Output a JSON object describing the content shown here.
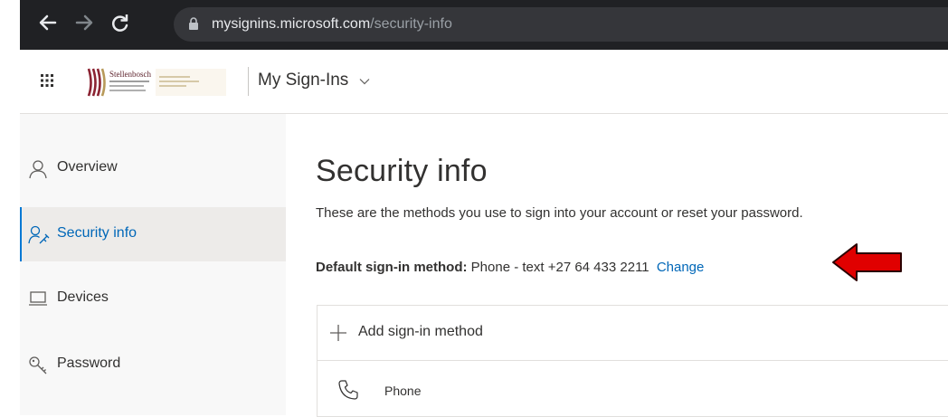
{
  "browser": {
    "url_host": "mysignins.microsoft.com",
    "url_path": "/security-info",
    "icons": [
      "back-arrow-icon",
      "forward-arrow-icon",
      "reload-icon",
      "lock-icon"
    ]
  },
  "header": {
    "org_name": "Stellenbosch",
    "app_title": "My Sign-Ins",
    "icons": [
      "waffle-icon",
      "chevron-down-icon"
    ]
  },
  "sidebar": {
    "items": [
      {
        "label": "Overview",
        "icon": "person-icon",
        "active": false
      },
      {
        "label": "Security info",
        "icon": "security-info-icon",
        "active": true
      },
      {
        "label": "Devices",
        "icon": "laptop-icon",
        "active": false
      },
      {
        "label": "Password",
        "icon": "key-icon",
        "active": false
      }
    ]
  },
  "main": {
    "title": "Security info",
    "description": "These are the methods you use to sign into your account or reset your password.",
    "default_method": {
      "label": "Default sign-in method:",
      "value": "Phone - text +27 64 433 2211",
      "change_link": "Change"
    },
    "add_method_label": "Add sign-in method",
    "methods": [
      {
        "type": "Phone",
        "icon": "phone-icon"
      }
    ]
  },
  "colors": {
    "accent": "#0067b8",
    "active_bar": "#0078d4",
    "annotation_arrow": "#e00000",
    "browser_bg": "#202124"
  }
}
